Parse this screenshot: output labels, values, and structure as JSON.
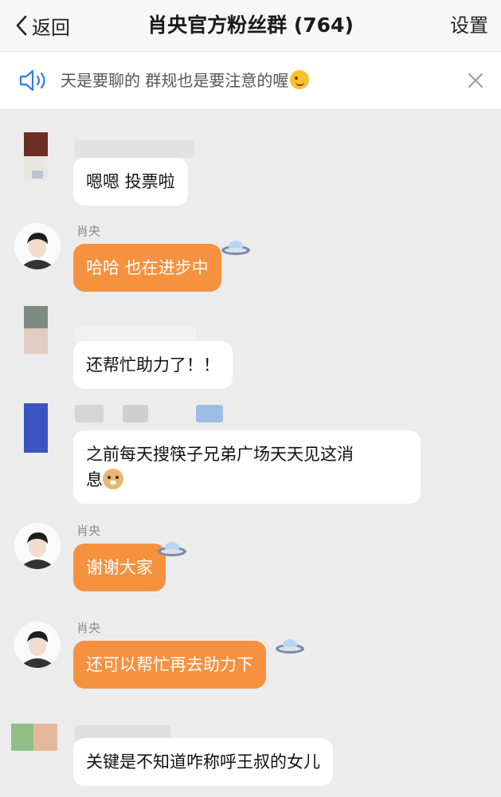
{
  "navbar": {
    "back_label": "返回",
    "title": "肖央官方粉丝群 (764)",
    "settings_label": "设置"
  },
  "notice": {
    "text": "天是要聊的 群规也是要注意的喔",
    "emoji": "wink-emoji"
  },
  "messages": [
    {
      "sender": "",
      "text": "嗯嗯 投票啦",
      "style": "white"
    },
    {
      "sender": "肖央",
      "text": "哈哈 也在进步中",
      "style": "orange",
      "decoration": "ufo-sticker"
    },
    {
      "sender": "",
      "text": "还帮忙助力了！！",
      "style": "white"
    },
    {
      "sender": "",
      "text_line1": "之前每天搜筷子兄弟广场天天见这消",
      "text_line2": "息",
      "style": "white",
      "emoji": "doge-emoji"
    },
    {
      "sender": "肖央",
      "text": "谢谢大家",
      "style": "orange",
      "decoration": "ufo-sticker"
    },
    {
      "sender": "肖央",
      "text": "还可以帮忙再去助力下",
      "style": "orange",
      "decoration": "ufo-sticker"
    },
    {
      "sender": "",
      "text": "关键是不知道咋称呼王叔的女儿",
      "style": "white"
    }
  ],
  "colors": {
    "background": "#ececec",
    "orange_bubble": "#f6913f",
    "white_bubble": "#ffffff"
  }
}
